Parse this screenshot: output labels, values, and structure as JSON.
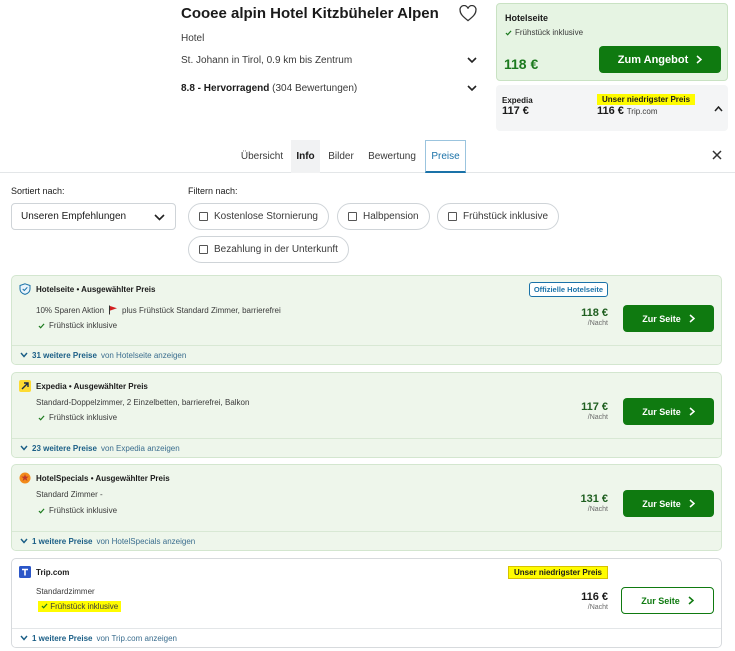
{
  "hotel": {
    "name": "Cooee alpin Hotel Kitzbüheler Alpen",
    "type": "Hotel",
    "location": "St. Johann in Tirol, 0.9 km bis Zentrum",
    "rating_score": "8.8 - Hervorragend",
    "rating_count": "(304 Bewertungen)"
  },
  "top_offer": {
    "provider": "Hotelseite",
    "included": "Frühstück inklusive",
    "price": "118 €",
    "button": "Zum Angebot"
  },
  "alt_offers": {
    "first_provider": "Expedia",
    "first_price": "117 €",
    "badge": "Unser niedrigster Preis",
    "second_price": "116 €",
    "second_site": "Trip.com"
  },
  "tabs": [
    "Übersicht",
    "Info",
    "Bilder",
    "Bewertung",
    "Preise"
  ],
  "active_tab": "Preise",
  "sort": {
    "label": "Sortiert nach:",
    "value": "Unseren Empfehlungen"
  },
  "filter": {
    "label": "Filtern nach:",
    "options": [
      "Kostenlose Stornierung",
      "Halbpension",
      "Frühstück inklusive",
      "Bezahlung in der Unterkunft"
    ]
  },
  "cards": [
    {
      "title": "Hotelseite • Ausgewählter Preis",
      "room_prefix": "10% Sparen Aktion",
      "room_suffix": "plus Frühstück Standard Zimmer, barrierefrei",
      "included": "Frühstück inklusive",
      "price": "118 €",
      "per_night": "/Nacht",
      "badge": "Offizielle Hotelseite",
      "button": "Zur Seite",
      "more_count": "31 weitere Preise",
      "more_suffix": "von Hotelseite anzeigen",
      "icon": "shield-icon"
    },
    {
      "title": "Expedia • Ausgewählter Preis",
      "room": "Standard-Doppelzimmer, 2 Einzelbetten, barrierefrei, Balkon",
      "included": "Frühstück inklusive",
      "price": "117 €",
      "per_night": "/Nacht",
      "button": "Zur Seite",
      "more_count": "23 weitere Preise",
      "more_suffix": "von Expedia anzeigen",
      "icon": "expedia-icon"
    },
    {
      "title": "HotelSpecials • Ausgewählter Preis",
      "room": "Standard Zimmer -",
      "included": "Frühstück inklusive",
      "price": "131 €",
      "per_night": "/Nacht",
      "button": "Zur Seite",
      "more_count": "1 weitere Preise",
      "more_suffix": "von HotelSpecials anzeigen",
      "icon": "hotelspecials-icon"
    },
    {
      "title": "Trip.com",
      "room": "Standardzimmer",
      "included": "Frühstück inklusive",
      "price": "116 €",
      "per_night": "/Nacht",
      "badge": "Unser niedrigster Preis",
      "button": "Zur Seite",
      "more_count": "1 weitere Preise",
      "more_suffix": "von Trip.com anzeigen",
      "icon": "tripcom-icon"
    }
  ],
  "colors": {
    "accent_green": "#0f7a10",
    "card_green_bg": "#eef6eb",
    "link_blue": "#1a72a8",
    "highlight": "#fffc00"
  }
}
